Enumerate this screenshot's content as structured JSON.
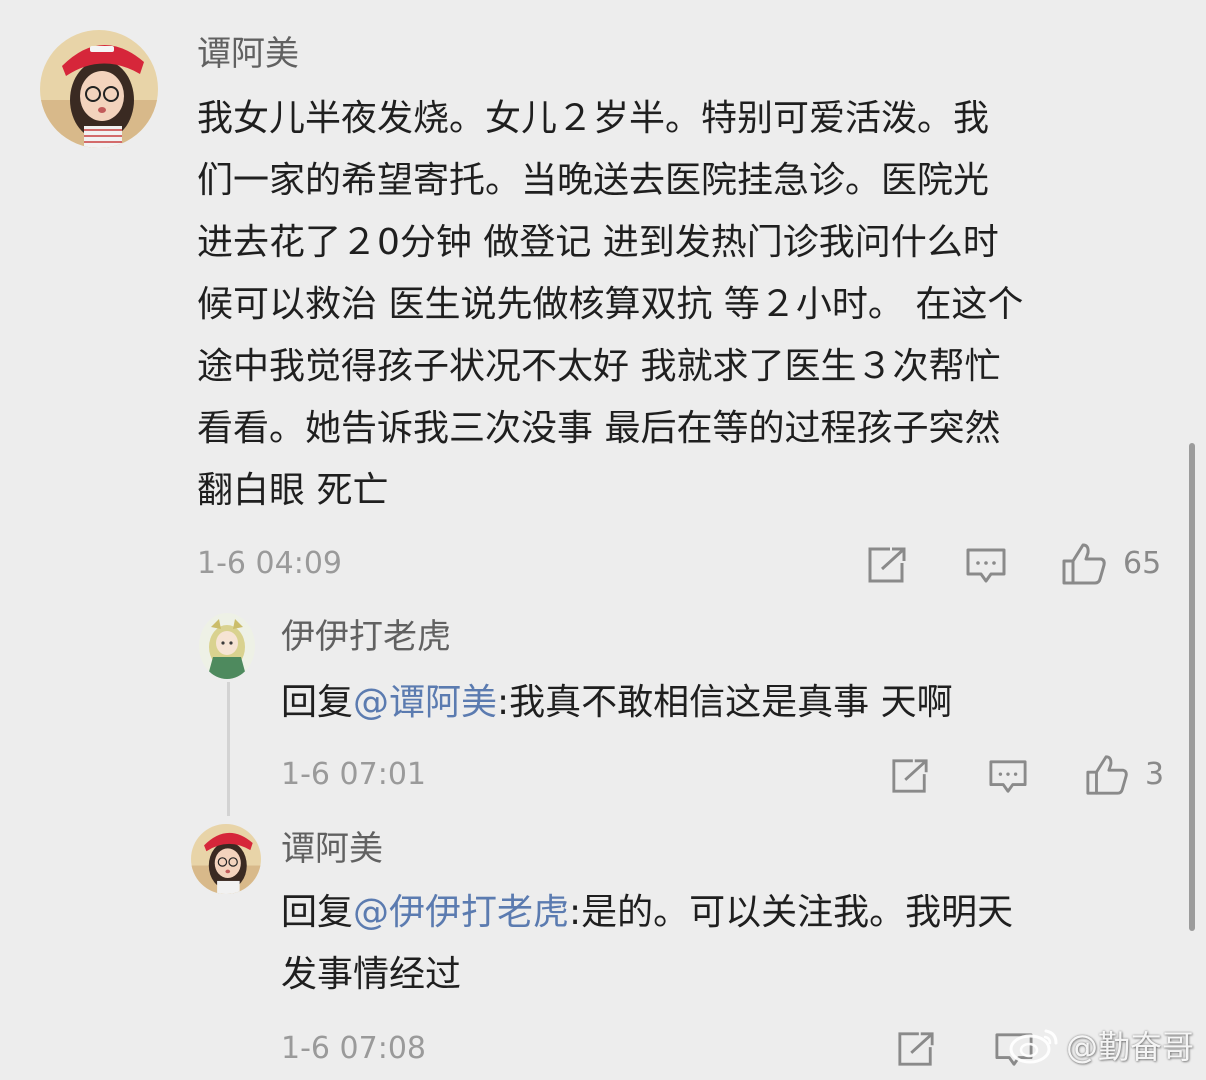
{
  "comment": {
    "username": "谭阿美",
    "lines": [
      "我女儿半夜发烧。女儿２岁半。特别可爱活泼。我",
      "们一家的希望寄托。当晚送去医院挂急诊。医院光",
      "进去花了２0分钟 做登记 进到发热门诊我问什么时",
      "候可以救治 医生说先做核算双抗 等２小时。 在这个",
      "途中我觉得孩子状况不太好 我就求了医生３次帮忙",
      "看看。她告诉我三次没事  最后在等的过程孩子突然",
      "翻白眼 死亡"
    ],
    "timestamp": "1-6 04:09",
    "like_count": "65"
  },
  "replies": [
    {
      "username": "伊伊打老虎",
      "reply_prefix": "回复",
      "mention": "@谭阿美",
      "text_lines": [
        ":我真不敢相信这是真事 天啊"
      ],
      "timestamp": "1-6 07:01",
      "like_count": "3"
    },
    {
      "username": "谭阿美",
      "reply_prefix": "回复",
      "mention": "@伊伊打老虎",
      "text_lines": [
        ":是的。可以关注我。我明天",
        "发事情经过"
      ],
      "timestamp": "1-6 07:08",
      "like_count": ""
    }
  ],
  "watermark": {
    "text": "@勤奋哥",
    "icon": "weibo-logo-icon"
  },
  "icons": {
    "share": "share-icon",
    "comment": "comment-icon",
    "like": "thumbs-up-icon"
  },
  "colors": {
    "background": "#ededed",
    "mention": "#5b7bb0",
    "username": "#616161",
    "meta": "#9a9a9a"
  }
}
